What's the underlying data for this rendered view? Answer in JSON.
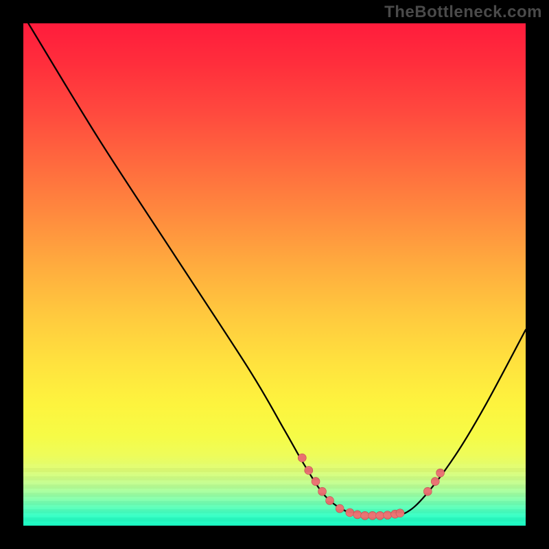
{
  "watermark": "TheBottleneck.com",
  "colors": {
    "page_bg": "#000000",
    "watermark": "#4a4a4a",
    "curve": "#000000",
    "marker_fill": "#e97070",
    "marker_stroke": "#c24f4f",
    "gradient_top": "#ff1c3c",
    "gradient_bottom": "#11f7bf"
  },
  "chart_data": {
    "type": "line",
    "title": "",
    "xlabel": "",
    "ylabel": "",
    "xlim": [
      0,
      100
    ],
    "ylim": [
      0,
      100
    ],
    "grid": false,
    "legend": false,
    "curve_points_xy": [
      [
        1,
        100
      ],
      [
        15,
        77
      ],
      [
        30,
        54
      ],
      [
        45,
        31
      ],
      [
        52,
        19
      ],
      [
        56,
        12
      ],
      [
        60,
        6
      ],
      [
        64,
        3
      ],
      [
        68,
        2
      ],
      [
        72,
        2
      ],
      [
        76,
        2.5
      ],
      [
        80,
        6
      ],
      [
        86,
        14
      ],
      [
        92,
        24
      ],
      [
        100,
        39
      ]
    ],
    "markers_xy": [
      [
        55.5,
        13.5
      ],
      [
        56.8,
        11
      ],
      [
        58.2,
        8.8
      ],
      [
        59.5,
        6.8
      ],
      [
        61,
        5
      ],
      [
        63,
        3.4
      ],
      [
        65,
        2.6
      ],
      [
        66.5,
        2.2
      ],
      [
        68,
        2
      ],
      [
        69.5,
        2
      ],
      [
        71,
        2
      ],
      [
        72.5,
        2.1
      ],
      [
        74,
        2.3
      ],
      [
        75,
        2.5
      ],
      [
        80.5,
        6.8
      ],
      [
        82,
        8.8
      ],
      [
        83,
        10.5
      ]
    ],
    "marker_radius": 6
  }
}
